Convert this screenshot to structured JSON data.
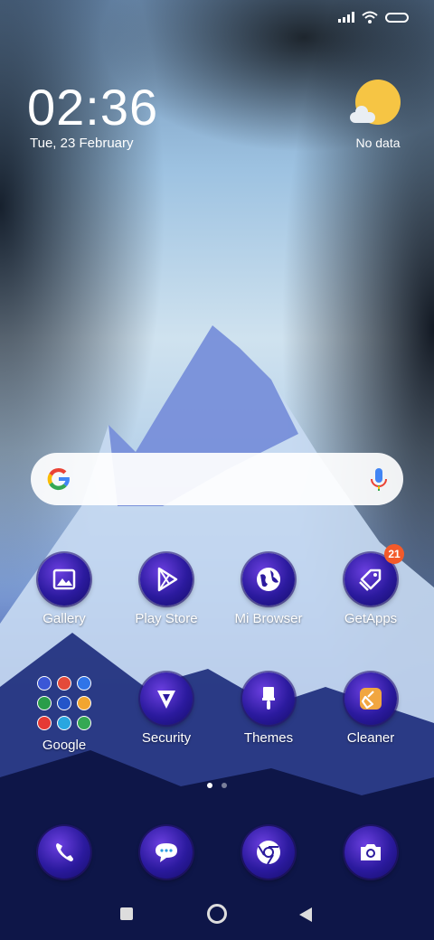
{
  "status_bar": {
    "icons": [
      "signal-icon",
      "wifi-icon",
      "battery-icon"
    ]
  },
  "clock": {
    "time": "02:36",
    "date": "Tue, 23 February"
  },
  "weather": {
    "icon": "sun-cloud-icon",
    "label": "No data"
  },
  "search": {
    "logo": "google-logo-icon",
    "mic": "mic-icon"
  },
  "apps_row1": [
    {
      "label": "Gallery"
    },
    {
      "label": "Play Store"
    },
    {
      "label": "Mi Browser"
    },
    {
      "label": "GetApps",
      "badge": "21"
    }
  ],
  "apps_row2": [
    {
      "label": "Google"
    },
    {
      "label": "Security"
    },
    {
      "label": "Themes"
    },
    {
      "label": "Cleaner"
    }
  ],
  "dock": [
    {
      "icon": "phone-icon"
    },
    {
      "icon": "messages-icon"
    },
    {
      "icon": "chrome-icon"
    },
    {
      "icon": "camera-icon"
    }
  ],
  "page_indicator": {
    "pages": 2,
    "current": 1
  },
  "nav_bar": {
    "icons": [
      "recents-icon",
      "home-icon",
      "back-icon"
    ]
  },
  "colors": {
    "icon_bg": "#2b1a9e",
    "badge": "#f35a2a",
    "sun": "#f6c544"
  }
}
